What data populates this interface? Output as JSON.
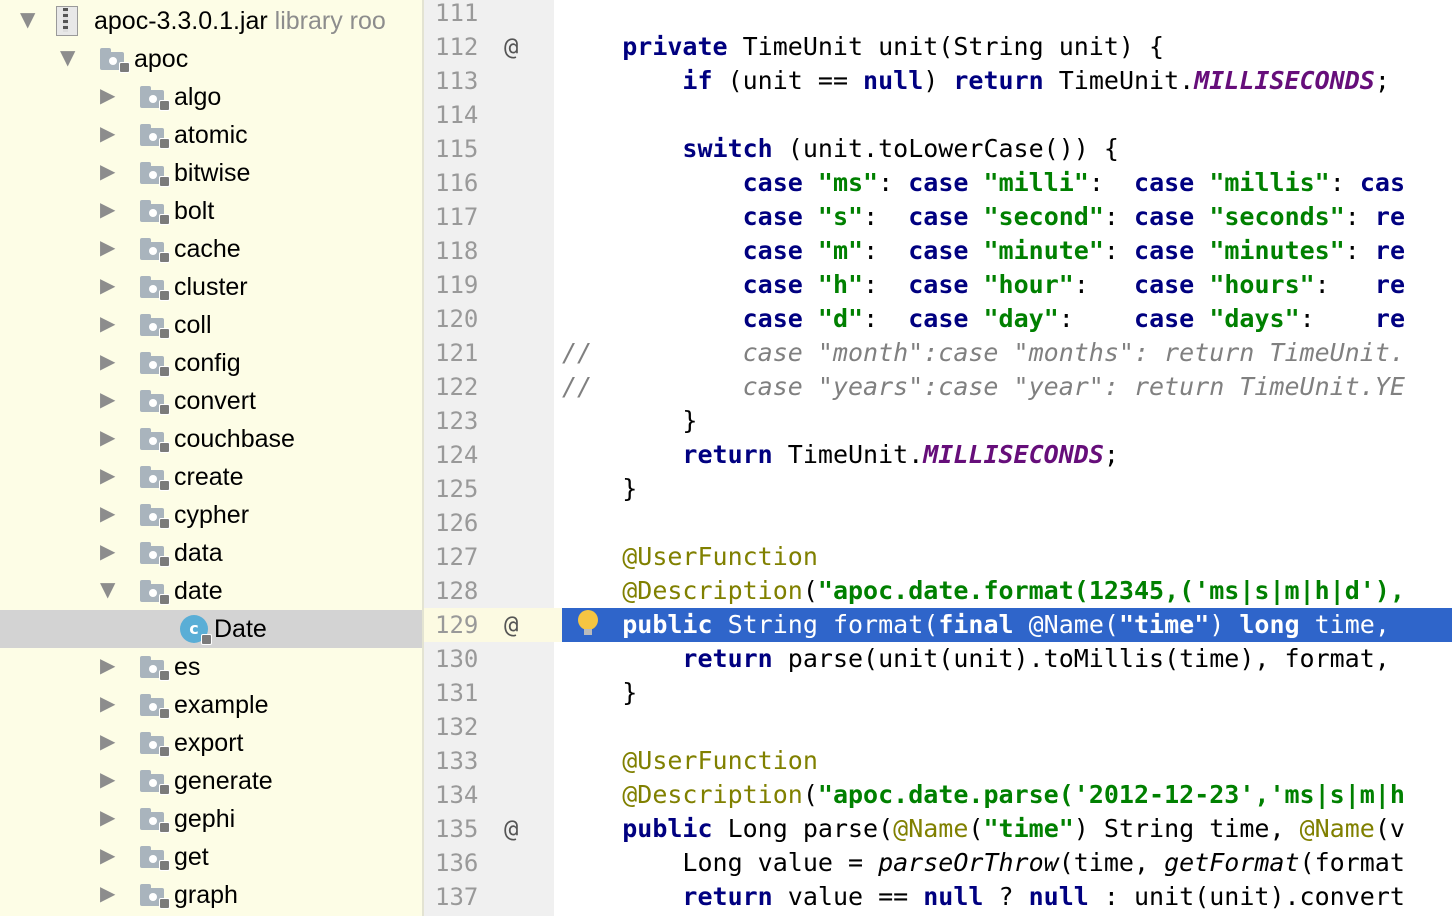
{
  "tree": {
    "root": {
      "label": "apoc-3.3.0.1.jar",
      "suffix": "library roo"
    },
    "package": {
      "label": "apoc"
    },
    "packages": [
      "algo",
      "atomic",
      "bitwise",
      "bolt",
      "cache",
      "cluster",
      "coll",
      "config",
      "convert",
      "couchbase",
      "create",
      "cypher",
      "data"
    ],
    "expanded_package": {
      "label": "date",
      "child_class": "Date",
      "class_icon_letter": "c"
    },
    "packages_after": [
      "es",
      "example",
      "export",
      "generate",
      "gephi",
      "get",
      "graph"
    ],
    "arrow_collapsed": "▶",
    "arrow_expanded": "▼",
    "icons": {
      "folder": "package-folder-icon",
      "jar": "jar-archive-icon",
      "class": "java-class-icon",
      "lock": "lock-icon"
    }
  },
  "gutter": {
    "lines": [
      {
        "num": "111",
        "mark": ""
      },
      {
        "num": "112",
        "mark": "@"
      },
      {
        "num": "113",
        "mark": ""
      },
      {
        "num": "114",
        "mark": ""
      },
      {
        "num": "115",
        "mark": ""
      },
      {
        "num": "116",
        "mark": ""
      },
      {
        "num": "117",
        "mark": ""
      },
      {
        "num": "118",
        "mark": ""
      },
      {
        "num": "119",
        "mark": ""
      },
      {
        "num": "120",
        "mark": ""
      },
      {
        "num": "121",
        "mark": ""
      },
      {
        "num": "122",
        "mark": ""
      },
      {
        "num": "123",
        "mark": ""
      },
      {
        "num": "124",
        "mark": ""
      },
      {
        "num": "125",
        "mark": ""
      },
      {
        "num": "126",
        "mark": ""
      },
      {
        "num": "127",
        "mark": ""
      },
      {
        "num": "128",
        "mark": ""
      },
      {
        "num": "129",
        "mark": "@"
      },
      {
        "num": "130",
        "mark": ""
      },
      {
        "num": "131",
        "mark": ""
      },
      {
        "num": "132",
        "mark": ""
      },
      {
        "num": "133",
        "mark": ""
      },
      {
        "num": "134",
        "mark": ""
      },
      {
        "num": "135",
        "mark": "@"
      },
      {
        "num": "136",
        "mark": ""
      },
      {
        "num": "137",
        "mark": ""
      }
    ],
    "active_line": "129"
  },
  "editor": {
    "code": [
      [],
      [
        [
          "    ",
          ""
        ],
        [
          "private",
          "kw"
        ],
        [
          " TimeUnit unit(String unit) {",
          ""
        ]
      ],
      [
        [
          "        ",
          ""
        ],
        [
          "if",
          "kw"
        ],
        [
          " (unit == ",
          ""
        ],
        [
          "null",
          "kw"
        ],
        [
          ") ",
          ""
        ],
        [
          "return",
          "kw"
        ],
        [
          " TimeUnit.",
          ""
        ],
        [
          "MILLISECONDS",
          "konst"
        ],
        [
          ";",
          ""
        ]
      ],
      [],
      [
        [
          "        ",
          ""
        ],
        [
          "switch",
          "kw"
        ],
        [
          " (unit.toLowerCase()) {",
          ""
        ]
      ],
      [
        [
          "            ",
          ""
        ],
        [
          "case",
          "kw"
        ],
        [
          " ",
          ""
        ],
        [
          "\"ms\"",
          "str"
        ],
        [
          ": ",
          ""
        ],
        [
          "case",
          "kw"
        ],
        [
          " ",
          ""
        ],
        [
          "\"milli\"",
          "str"
        ],
        [
          ":  ",
          ""
        ],
        [
          "case",
          "kw"
        ],
        [
          " ",
          ""
        ],
        [
          "\"millis\"",
          "str"
        ],
        [
          ": ",
          ""
        ],
        [
          "cas",
          "kw"
        ]
      ],
      [
        [
          "            ",
          ""
        ],
        [
          "case",
          "kw"
        ],
        [
          " ",
          ""
        ],
        [
          "\"s\"",
          "str"
        ],
        [
          ":  ",
          ""
        ],
        [
          "case",
          "kw"
        ],
        [
          " ",
          ""
        ],
        [
          "\"second\"",
          "str"
        ],
        [
          ": ",
          ""
        ],
        [
          "case",
          "kw"
        ],
        [
          " ",
          ""
        ],
        [
          "\"seconds\"",
          "str"
        ],
        [
          ": ",
          ""
        ],
        [
          "re",
          "kw"
        ]
      ],
      [
        [
          "            ",
          ""
        ],
        [
          "case",
          "kw"
        ],
        [
          " ",
          ""
        ],
        [
          "\"m\"",
          "str"
        ],
        [
          ":  ",
          ""
        ],
        [
          "case",
          "kw"
        ],
        [
          " ",
          ""
        ],
        [
          "\"minute\"",
          "str"
        ],
        [
          ": ",
          ""
        ],
        [
          "case",
          "kw"
        ],
        [
          " ",
          ""
        ],
        [
          "\"minutes\"",
          "str"
        ],
        [
          ": ",
          ""
        ],
        [
          "re",
          "kw"
        ]
      ],
      [
        [
          "            ",
          ""
        ],
        [
          "case",
          "kw"
        ],
        [
          " ",
          ""
        ],
        [
          "\"h\"",
          "str"
        ],
        [
          ":  ",
          ""
        ],
        [
          "case",
          "kw"
        ],
        [
          " ",
          ""
        ],
        [
          "\"hour\"",
          "str"
        ],
        [
          ":   ",
          ""
        ],
        [
          "case",
          "kw"
        ],
        [
          " ",
          ""
        ],
        [
          "\"hours\"",
          "str"
        ],
        [
          ":   ",
          ""
        ],
        [
          "re",
          "kw"
        ]
      ],
      [
        [
          "            ",
          ""
        ],
        [
          "case",
          "kw"
        ],
        [
          " ",
          ""
        ],
        [
          "\"d\"",
          "str"
        ],
        [
          ":  ",
          ""
        ],
        [
          "case",
          "kw"
        ],
        [
          " ",
          ""
        ],
        [
          "\"day\"",
          "str"
        ],
        [
          ":    ",
          ""
        ],
        [
          "case",
          "kw"
        ],
        [
          " ",
          ""
        ],
        [
          "\"days\"",
          "str"
        ],
        [
          ":    ",
          ""
        ],
        [
          "re",
          "kw"
        ]
      ],
      [
        [
          "//          case \"month\":case \"months\": return TimeUnit.",
          "cmt"
        ]
      ],
      [
        [
          "//          case \"years\":case \"year\": return TimeUnit.YE",
          "cmt"
        ]
      ],
      [
        [
          "        }",
          ""
        ]
      ],
      [
        [
          "        ",
          ""
        ],
        [
          "return",
          "kw"
        ],
        [
          " TimeUnit.",
          ""
        ],
        [
          "MILLISECONDS",
          "konst"
        ],
        [
          ";",
          ""
        ]
      ],
      [
        [
          "    }",
          ""
        ]
      ],
      [],
      [
        [
          "    ",
          ""
        ],
        [
          "@UserFunction",
          "ann"
        ]
      ],
      [
        [
          "    ",
          ""
        ],
        [
          "@Description",
          "ann"
        ],
        [
          "(",
          ""
        ],
        [
          "\"apoc.date.format(12345,('ms|s|m|h|d'),",
          "str"
        ]
      ],
      [
        [
          "    ",
          ""
        ],
        [
          "public",
          "kw"
        ],
        [
          " String format(",
          ""
        ],
        [
          "final",
          "kw"
        ],
        [
          " @Name(",
          ""
        ],
        [
          "\"time\"",
          "str"
        ],
        [
          ") ",
          ""
        ],
        [
          "long",
          "kw"
        ],
        [
          " time,",
          ""
        ]
      ],
      [
        [
          "        ",
          ""
        ],
        [
          "return",
          "kw"
        ],
        [
          " parse(unit(unit).toMillis(time), format,",
          ""
        ]
      ],
      [
        [
          "    }",
          ""
        ]
      ],
      [],
      [
        [
          "    ",
          ""
        ],
        [
          "@UserFunction",
          "ann"
        ]
      ],
      [
        [
          "    ",
          ""
        ],
        [
          "@Description",
          "ann"
        ],
        [
          "(",
          ""
        ],
        [
          "\"apoc.date.parse('2012-12-23','ms|s|m|h",
          "str"
        ]
      ],
      [
        [
          "    ",
          ""
        ],
        [
          "public",
          "kw"
        ],
        [
          " Long parse(",
          ""
        ],
        [
          "@Name",
          "ann"
        ],
        [
          "(",
          ""
        ],
        [
          "\"time\"",
          "str"
        ],
        [
          ") String time, ",
          ""
        ],
        [
          "@Name",
          "ann"
        ],
        [
          "(v",
          ""
        ]
      ],
      [
        [
          "        Long value = ",
          ""
        ],
        [
          "parseOrThrow",
          "itf"
        ],
        [
          "(time, ",
          ""
        ],
        [
          "getFormat",
          "itf"
        ],
        [
          "(format",
          ""
        ]
      ],
      [
        [
          "        ",
          ""
        ],
        [
          "return",
          "kw"
        ],
        [
          " value == ",
          ""
        ],
        [
          "null",
          "kw"
        ],
        [
          " ? ",
          ""
        ],
        [
          "null",
          "kw"
        ],
        [
          " : unit(unit).convert",
          ""
        ]
      ]
    ],
    "highlighted_line": "129",
    "intention_icon": "lightbulb-icon"
  },
  "colors": {
    "keyword": "#000080",
    "string": "#008000",
    "annotation": "#808000",
    "constant": "#660e7a",
    "comment": "#808080",
    "selection": "#2f65ca",
    "sidebar_bg": "#fdfde6"
  }
}
